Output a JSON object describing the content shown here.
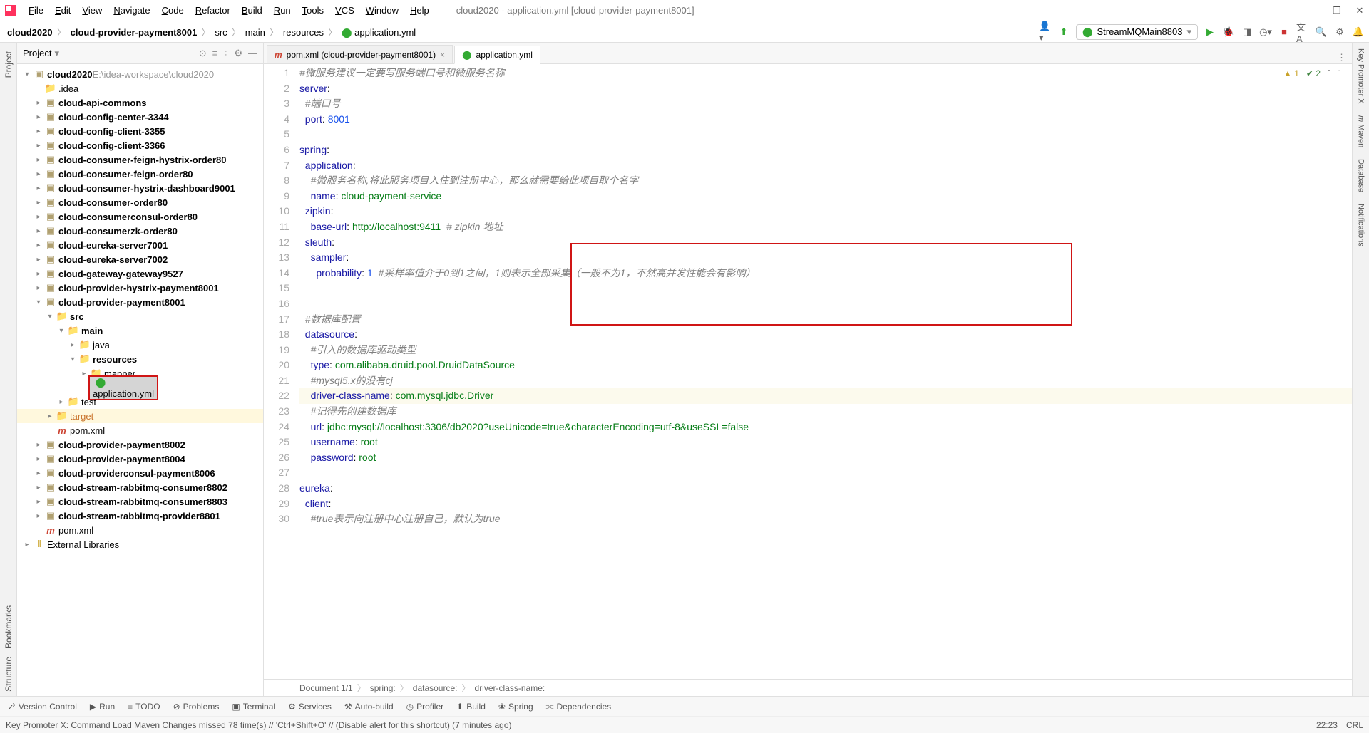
{
  "window_title": "cloud2020 - application.yml [cloud-provider-payment8001]",
  "menu": [
    "File",
    "Edit",
    "View",
    "Navigate",
    "Code",
    "Refactor",
    "Build",
    "Run",
    "Tools",
    "VCS",
    "Window",
    "Help"
  ],
  "breadcrumbs": [
    "cloud2020",
    "cloud-provider-payment8001",
    "src",
    "main",
    "resources",
    "application.yml"
  ],
  "run_config": "StreamMQMain8803",
  "project_header": "Project",
  "tree_root": {
    "name": "cloud2020",
    "hint": " E:\\idea-workspace\\cloud2020"
  },
  "tree": [
    {
      "name": ".idea",
      "d": 1,
      "t": "folder"
    },
    {
      "name": "cloud-api-commons",
      "d": 1,
      "t": "module",
      "c": true
    },
    {
      "name": "cloud-config-center-3344",
      "d": 1,
      "t": "module",
      "c": true
    },
    {
      "name": "cloud-config-client-3355",
      "d": 1,
      "t": "module",
      "c": true
    },
    {
      "name": "cloud-config-client-3366",
      "d": 1,
      "t": "module",
      "c": true
    },
    {
      "name": "cloud-consumer-feign-hystrix-order80",
      "d": 1,
      "t": "module",
      "c": true
    },
    {
      "name": "cloud-consumer-feign-order80",
      "d": 1,
      "t": "module",
      "c": true
    },
    {
      "name": "cloud-consumer-hystrix-dashboard9001",
      "d": 1,
      "t": "module",
      "c": true
    },
    {
      "name": "cloud-consumer-order80",
      "d": 1,
      "t": "module",
      "c": true
    },
    {
      "name": "cloud-consumerconsul-order80",
      "d": 1,
      "t": "module",
      "c": true
    },
    {
      "name": "cloud-consumerzk-order80",
      "d": 1,
      "t": "module",
      "c": true
    },
    {
      "name": "cloud-eureka-server7001",
      "d": 1,
      "t": "module",
      "c": true
    },
    {
      "name": "cloud-eureka-server7002",
      "d": 1,
      "t": "module",
      "c": true
    },
    {
      "name": "cloud-gateway-gateway9527",
      "d": 1,
      "t": "module",
      "c": true
    },
    {
      "name": "cloud-provider-hystrix-payment8001",
      "d": 1,
      "t": "module",
      "c": true
    },
    {
      "name": "cloud-provider-payment8001",
      "d": 1,
      "t": "module",
      "c": true,
      "open": true
    },
    {
      "name": "src",
      "d": 2,
      "t": "folder",
      "c": true,
      "open": true
    },
    {
      "name": "main",
      "d": 3,
      "t": "folder",
      "c": true,
      "open": true
    },
    {
      "name": "java",
      "d": 4,
      "t": "folder",
      "c": true
    },
    {
      "name": "resources",
      "d": 4,
      "t": "folder",
      "c": true,
      "open": true
    },
    {
      "name": "mapper",
      "d": 5,
      "t": "folder",
      "c": true
    },
    {
      "name": "application.yml",
      "d": 5,
      "t": "yml",
      "sel": true
    },
    {
      "name": "test",
      "d": 3,
      "t": "folder",
      "c": true
    },
    {
      "name": "target",
      "d": 2,
      "t": "folder",
      "c": true,
      "hl": true
    },
    {
      "name": "pom.xml",
      "d": 2,
      "t": "pom"
    },
    {
      "name": "cloud-provider-payment8002",
      "d": 1,
      "t": "module",
      "c": true
    },
    {
      "name": "cloud-provider-payment8004",
      "d": 1,
      "t": "module",
      "c": true
    },
    {
      "name": "cloud-providerconsul-payment8006",
      "d": 1,
      "t": "module",
      "c": true
    },
    {
      "name": "cloud-stream-rabbitmq-consumer8802",
      "d": 1,
      "t": "module",
      "c": true
    },
    {
      "name": "cloud-stream-rabbitmq-consumer8803",
      "d": 1,
      "t": "module",
      "c": true
    },
    {
      "name": "cloud-stream-rabbitmq-provider8801",
      "d": 1,
      "t": "module",
      "c": true
    },
    {
      "name": "pom.xml",
      "d": 1,
      "t": "pom"
    },
    {
      "name": "External Libraries",
      "d": 0,
      "t": "lib",
      "c": true
    }
  ],
  "tabs": [
    {
      "label": "pom.xml (cloud-provider-payment8001)",
      "icon": "pom",
      "active": false
    },
    {
      "label": "application.yml",
      "icon": "yml",
      "active": true
    }
  ],
  "inspections": {
    "warn": "1",
    "weak": "2"
  },
  "code": [
    {
      "n": 1,
      "seg": [
        {
          "t": "#微服务建议一定要写服务端口号和微服务名称",
          "c": "comment"
        }
      ]
    },
    {
      "n": 2,
      "seg": [
        {
          "t": "server",
          "c": "key"
        },
        {
          "t": ":"
        }
      ]
    },
    {
      "n": 3,
      "seg": [
        {
          "t": "  "
        },
        {
          "t": "#端口号",
          "c": "comment"
        }
      ]
    },
    {
      "n": 4,
      "seg": [
        {
          "t": "  "
        },
        {
          "t": "port",
          "c": "key"
        },
        {
          "t": ": "
        },
        {
          "t": "8001",
          "c": "num"
        }
      ]
    },
    {
      "n": 5,
      "seg": [
        {
          "t": ""
        }
      ]
    },
    {
      "n": 6,
      "seg": [
        {
          "t": "spring",
          "c": "key"
        },
        {
          "t": ":"
        }
      ]
    },
    {
      "n": 7,
      "seg": [
        {
          "t": "  "
        },
        {
          "t": "application",
          "c": "key"
        },
        {
          "t": ":"
        }
      ]
    },
    {
      "n": 8,
      "seg": [
        {
          "t": "    "
        },
        {
          "t": "#微服务名称,将此服务项目入住到注册中心，那么就需要给此项目取个名字",
          "c": "comment"
        }
      ]
    },
    {
      "n": 9,
      "seg": [
        {
          "t": "    "
        },
        {
          "t": "name",
          "c": "key"
        },
        {
          "t": ": "
        },
        {
          "t": "cloud-payment-service",
          "c": "str"
        }
      ]
    },
    {
      "n": 10,
      "seg": [
        {
          "t": "  "
        },
        {
          "t": "zipkin",
          "c": "key"
        },
        {
          "t": ":"
        }
      ]
    },
    {
      "n": 11,
      "seg": [
        {
          "t": "    "
        },
        {
          "t": "base-url",
          "c": "key"
        },
        {
          "t": ": "
        },
        {
          "t": "http://localhost:9411",
          "c": "str"
        },
        {
          "t": "  "
        },
        {
          "t": "# zipkin 地址",
          "c": "comment"
        }
      ]
    },
    {
      "n": 12,
      "seg": [
        {
          "t": "  "
        },
        {
          "t": "sleuth",
          "c": "key"
        },
        {
          "t": ":"
        }
      ]
    },
    {
      "n": 13,
      "seg": [
        {
          "t": "    "
        },
        {
          "t": "sampler",
          "c": "key"
        },
        {
          "t": ":"
        }
      ]
    },
    {
      "n": 14,
      "seg": [
        {
          "t": "      "
        },
        {
          "t": "probability",
          "c": "key"
        },
        {
          "t": ": "
        },
        {
          "t": "1",
          "c": "num"
        },
        {
          "t": "  "
        },
        {
          "t": "#采样率值介于0到1之间，1则表示全部采集（一般不为1，不然高并发性能会有影响）",
          "c": "comment"
        }
      ]
    },
    {
      "n": 15,
      "seg": [
        {
          "t": ""
        }
      ]
    },
    {
      "n": 16,
      "seg": [
        {
          "t": ""
        }
      ]
    },
    {
      "n": 17,
      "seg": [
        {
          "t": "  "
        },
        {
          "t": "#数据库配置",
          "c": "comment"
        }
      ]
    },
    {
      "n": 18,
      "seg": [
        {
          "t": "  "
        },
        {
          "t": "datasource",
          "c": "key"
        },
        {
          "t": ":"
        }
      ]
    },
    {
      "n": 19,
      "seg": [
        {
          "t": "    "
        },
        {
          "t": "#引入的数据库驱动类型",
          "c": "comment"
        }
      ]
    },
    {
      "n": 20,
      "seg": [
        {
          "t": "    "
        },
        {
          "t": "type",
          "c": "key"
        },
        {
          "t": ": "
        },
        {
          "t": "com.alibaba.druid.pool.DruidDataSource",
          "c": "str"
        }
      ]
    },
    {
      "n": 21,
      "seg": [
        {
          "t": "    "
        },
        {
          "t": "#mysql5.x的没有cj",
          "c": "comment"
        }
      ]
    },
    {
      "n": 22,
      "seg": [
        {
          "t": "    "
        },
        {
          "t": "driver-class-name",
          "c": "key"
        },
        {
          "t": ": "
        },
        {
          "t": "com.mysql.jdbc.Driver",
          "c": "str"
        }
      ],
      "cur": true
    },
    {
      "n": 23,
      "seg": [
        {
          "t": "    "
        },
        {
          "t": "#记得先创建数据库",
          "c": "comment"
        }
      ]
    },
    {
      "n": 24,
      "seg": [
        {
          "t": "    "
        },
        {
          "t": "url",
          "c": "key"
        },
        {
          "t": ": "
        },
        {
          "t": "jdbc:mysql://localhost:3306/db2020?useUnicode=true&characterEncoding=utf-8&useSSL=false",
          "c": "str"
        }
      ]
    },
    {
      "n": 25,
      "seg": [
        {
          "t": "    "
        },
        {
          "t": "username",
          "c": "key"
        },
        {
          "t": ": "
        },
        {
          "t": "root",
          "c": "str"
        }
      ]
    },
    {
      "n": 26,
      "seg": [
        {
          "t": "    "
        },
        {
          "t": "password",
          "c": "key"
        },
        {
          "t": ": "
        },
        {
          "t": "root",
          "c": "str"
        }
      ]
    },
    {
      "n": 27,
      "seg": [
        {
          "t": ""
        }
      ]
    },
    {
      "n": 28,
      "seg": [
        {
          "t": "eureka",
          "c": "key"
        },
        {
          "t": ":"
        }
      ]
    },
    {
      "n": 29,
      "seg": [
        {
          "t": "  "
        },
        {
          "t": "client",
          "c": "key"
        },
        {
          "t": ":"
        }
      ]
    },
    {
      "n": 30,
      "seg": [
        {
          "t": "    "
        },
        {
          "t": "#true表示向注册中心注册自己，默认为true",
          "c": "comment"
        }
      ]
    }
  ],
  "crumbs2": [
    "Document 1/1",
    "spring:",
    "datasource:",
    "driver-class-name:"
  ],
  "bottom": [
    "Version Control",
    "Run",
    "TODO",
    "Problems",
    "Terminal",
    "Services",
    "Auto-build",
    "Profiler",
    "Build",
    "Spring",
    "Dependencies"
  ],
  "status_msg": "Key Promoter X: Command Load Maven Changes missed 78 time(s) // 'Ctrl+Shift+O' // (Disable alert for this shortcut) (7 minutes ago)",
  "status_right": [
    "22:23",
    "CRL"
  ],
  "right_tabs": [
    "Key Promoter X",
    "Maven",
    "Database",
    "Notifications"
  ],
  "left_tabs": [
    "Project",
    "Bookmarks",
    "Structure"
  ]
}
